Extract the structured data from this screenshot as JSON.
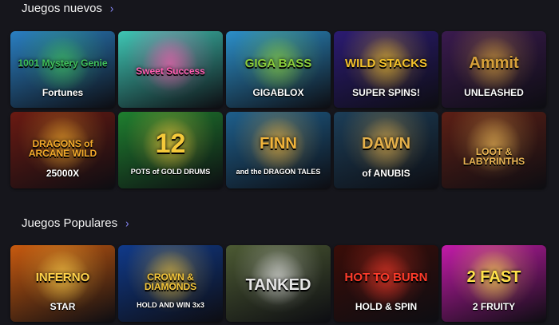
{
  "sections": {
    "new": {
      "title": "Juegos nuevos",
      "chevron": "›"
    },
    "popular": {
      "title": "Juegos Populares",
      "chevron": "›"
    }
  },
  "new_games": [
    {
      "title": "1001 Mystery Genie",
      "sub": "Fortunes",
      "bg": "#2a7fc2",
      "accent": "#3fbf5a"
    },
    {
      "title": "Sweet Success",
      "sub": "",
      "bg": "#3fc6b4",
      "accent": "#ff5db1"
    },
    {
      "title": "GIGA BASS",
      "sub": "GIGABLOX",
      "bg": "#2c8fc9",
      "accent": "#8bcf3b"
    },
    {
      "title": "WILD STACKS",
      "sub": "SUPER SPINS!",
      "bg": "#2b1b72",
      "accent": "#f4c22b"
    },
    {
      "title": "Ammit",
      "sub": "UNLEASHED",
      "bg": "#3a1a4e",
      "accent": "#d8a13a"
    },
    {
      "title": "DRAGONS of ARCANE WILD",
      "sub": "25000X",
      "bg": "#6a1a12",
      "accent": "#f1a92b"
    },
    {
      "title": "12",
      "sub": "POTS of GOLD DRUMS",
      "bg": "#1f7f2f",
      "accent": "#f5c93a"
    },
    {
      "title": "FINN",
      "sub": "and the DRAGON TALES",
      "bg": "#1e5f8c",
      "accent": "#f2b43a"
    },
    {
      "title": "DAWN",
      "sub": "of ANUBIS",
      "bg": "#1c3e58",
      "accent": "#e4b04a"
    },
    {
      "title": "LOOT & LABYRINTHS",
      "sub": "",
      "bg": "#5c1f15",
      "accent": "#e9b554"
    }
  ],
  "popular_games": [
    {
      "title": "INFERNO",
      "sub": "STAR",
      "bg": "#c85a0f",
      "accent": "#ffd24a"
    },
    {
      "title": "CROWN & DIAMONDS",
      "sub": "HOLD AND WIN 3x3",
      "bg": "#103a8a",
      "accent": "#f3c53a"
    },
    {
      "title": "TANKED",
      "sub": "",
      "bg": "#4c5a33",
      "accent": "#e6e6e6"
    },
    {
      "title": "HOT TO BURN",
      "sub": "HOLD & SPIN",
      "bg": "#3a0d08",
      "accent": "#ff3b2a"
    },
    {
      "title": "2 FAST",
      "sub": "2 FRUITY",
      "bg": "#c31ba9",
      "accent": "#ffe14a"
    }
  ]
}
